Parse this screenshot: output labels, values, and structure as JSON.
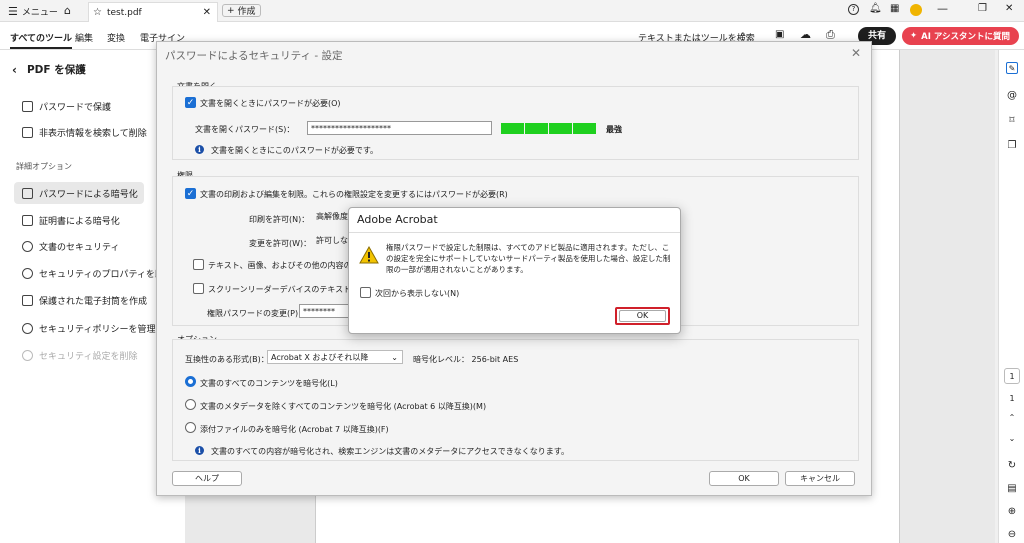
{
  "titlebar": {
    "menu": "メニュー",
    "tab_title": "test.pdf",
    "new_tab": "作成"
  },
  "toolbar": {
    "tabs": [
      "すべてのツール",
      "編集",
      "変換",
      "電子サイン"
    ],
    "search": "テキストまたはツールを検索",
    "share": "共有",
    "ai": "AI アシスタントに質問"
  },
  "left_panel": {
    "back_title": "PDF を保護",
    "items1": [
      "パスワードで保護",
      "非表示情報を検索して削除"
    ],
    "section": "詳細オプション",
    "items2": [
      "パスワードによる暗号化",
      "証明書による暗号化",
      "文書のセキュリティ",
      "セキュリティのプロパティを既",
      "保護された電子封筒を作成",
      "セキュリティポリシーを管理",
      "セキュリティ設定を削除"
    ]
  },
  "dialog": {
    "title": "パスワードによるセキュリティ - 設定",
    "open_group": "文書を開く",
    "open_cb": "文書を開くときにパスワードが必要(O)",
    "open_pw_label": "文書を開くパスワード(S)：",
    "open_pw_value": "********************",
    "strength": "最強",
    "open_info": "文書を開くときにこのパスワードが必要です。",
    "perm_group": "権限",
    "perm_cb": "文書の印刷および編集を制限。これらの権限設定を変更するにはパスワードが必要(R)",
    "print_label": "印刷を許可(N)：",
    "print_value": "高解像度",
    "change_label": "変更を許可(W)：",
    "change_value": "許可しない",
    "copy_cb": "テキスト、画像、およびその他の内容のコピ",
    "reader_cb": "スクリーンリーダーデバイスのテキストアクセス",
    "perm_pw_label": "権限パスワードの変更(P)：",
    "perm_pw_value": "********",
    "opt_group": "オプション",
    "compat_label": "互換性のある形式(B)：",
    "compat_value": "Acrobat X およびそれ以降",
    "enc_level": "暗号化レベル：  256-bit AES",
    "radios": [
      "文書のすべてのコンテンツを暗号化(L)",
      "文書のメタデータを除くすべてのコンテンツを暗号化 (Acrobat 6 以降互換)(M)",
      "添付ファイルのみを暗号化 (Acrobat 7 以降互換)(F)"
    ],
    "opt_info": "文書のすべての内容が暗号化され、検索エンジンは文書のメタデータにアクセスできなくなります。",
    "help": "ヘルプ",
    "ok": "OK",
    "cancel": "キャンセル"
  },
  "alert": {
    "title": "Adobe Acrobat",
    "message": "権限パスワードで設定した制限は、すべてのアドビ製品に適用されます。ただし、この設定を完全にサポートしていないサードパーティ製品を使用した場合、設定した制限の一部が適用されないことがあります。",
    "checkbox": "次回から表示しない(N)",
    "ok": "OK",
    "highlight_color": "#d0202a"
  },
  "right_bar": {
    "page_current": "1",
    "page_total": "1"
  }
}
